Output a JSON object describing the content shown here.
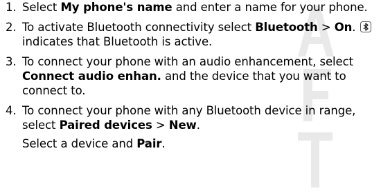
{
  "watermark": {
    "letters": "AFT"
  },
  "steps": [
    {
      "number": "1.",
      "parts": [
        "Select ",
        "My phone's name",
        " and enter a name for your phone."
      ]
    },
    {
      "number": "2.",
      "parts": [
        "To activate Bluetooth connectivity select ",
        "Bluetooth",
        " > ",
        "On",
        ".",
        " indicates that Bluetooth is active."
      ]
    },
    {
      "number": "3.",
      "parts": [
        "To connect your phone with an audio enhancement, select ",
        "Connect audio enhan.",
        " and the device that you want to connect to."
      ]
    },
    {
      "number": "4.",
      "parts": [
        "To connect your phone with any Bluetooth device in range, select ",
        "Paired devices",
        " > ",
        "New",
        "."
      ],
      "sub_parts": [
        "Select a device and ",
        "Pair",
        "."
      ]
    }
  ],
  "icons": {
    "bluetooth": "bluetooth-icon"
  }
}
